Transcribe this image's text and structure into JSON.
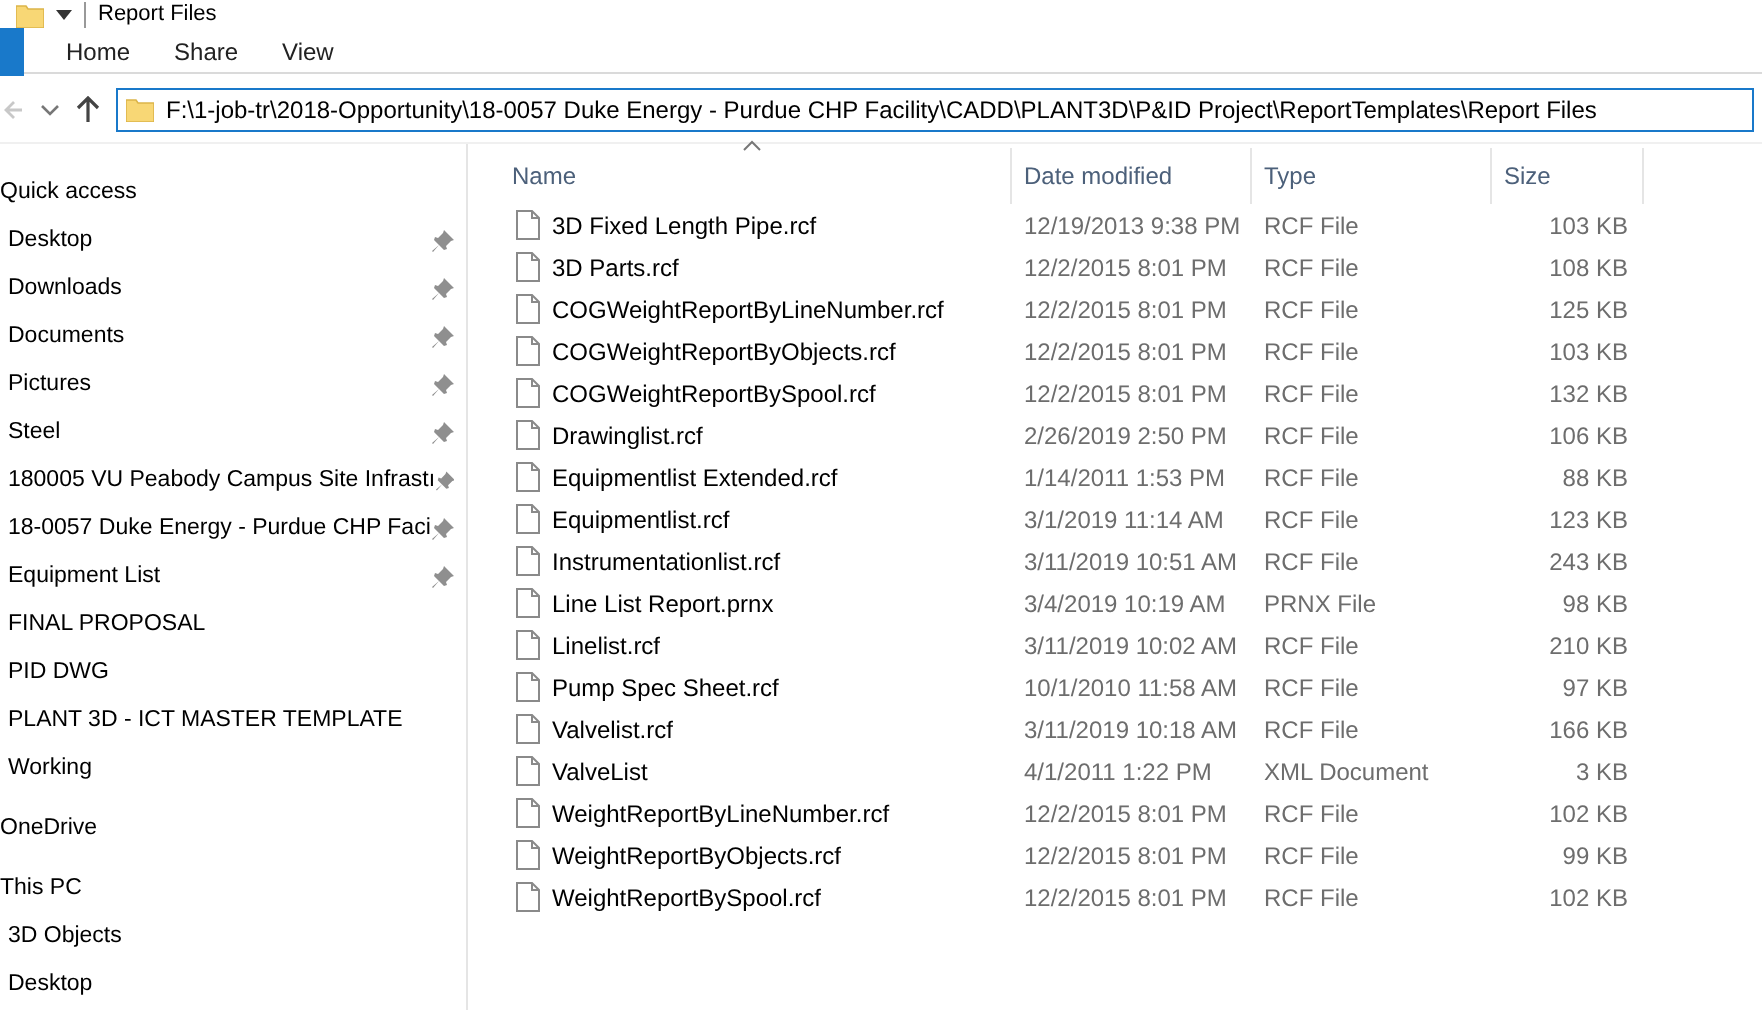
{
  "window": {
    "title": "Report Files"
  },
  "ribbon_tabs": [
    {
      "label": "Home",
      "selected": false
    },
    {
      "label": "Share",
      "selected": false
    },
    {
      "label": "View",
      "selected": false
    }
  ],
  "address": {
    "value": "F:\\1-job-tr\\2018-Opportunity\\18-0057 Duke Energy - Purdue CHP Facility\\CADD\\PLANT3D\\P&ID Project\\ReportTemplates\\Report Files"
  },
  "sidebar": {
    "items": [
      {
        "label": "Quick access",
        "children": [
          {
            "label": "Desktop",
            "pinned": true
          },
          {
            "label": "Downloads",
            "pinned": true
          },
          {
            "label": "Documents",
            "pinned": true
          },
          {
            "label": "Pictures",
            "pinned": true
          },
          {
            "label": "Steel",
            "pinned": true
          },
          {
            "label": "180005 VU Peabody Campus Site Infrastı",
            "pinned": true
          },
          {
            "label": "18-0057 Duke Energy - Purdue CHP Faci",
            "pinned": true
          },
          {
            "label": "Equipment List",
            "pinned": true
          },
          {
            "label": "FINAL PROPOSAL",
            "pinned": false
          },
          {
            "label": "PID DWG",
            "pinned": false
          },
          {
            "label": "PLANT 3D - ICT MASTER TEMPLATE",
            "pinned": false
          },
          {
            "label": "Working",
            "pinned": false
          }
        ]
      },
      {
        "label": "OneDrive"
      },
      {
        "label": "This PC",
        "children": [
          {
            "label": "3D Objects",
            "pinned": false
          },
          {
            "label": "Desktop",
            "pinned": false
          }
        ]
      }
    ]
  },
  "table": {
    "columns": [
      "Name",
      "Date modified",
      "Type",
      "Size"
    ],
    "rows": [
      [
        "3D Fixed Length Pipe.rcf",
        "12/19/2013 9:38 PM",
        "RCF File",
        "103 KB"
      ],
      [
        "3D Parts.rcf",
        "12/2/2015 8:01 PM",
        "RCF File",
        "108 KB"
      ],
      [
        "COGWeightReportByLineNumber.rcf",
        "12/2/2015 8:01 PM",
        "RCF File",
        "125 KB"
      ],
      [
        "COGWeightReportByObjects.rcf",
        "12/2/2015 8:01 PM",
        "RCF File",
        "103 KB"
      ],
      [
        "COGWeightReportBySpool.rcf",
        "12/2/2015 8:01 PM",
        "RCF File",
        "132 KB"
      ],
      [
        "Drawinglist.rcf",
        "2/26/2019 2:50 PM",
        "RCF File",
        "106 KB"
      ],
      [
        "Equipmentlist Extended.rcf",
        "1/14/2011 1:53 PM",
        "RCF File",
        "88 KB"
      ],
      [
        "Equipmentlist.rcf",
        "3/1/2019 11:14 AM",
        "RCF File",
        "123 KB"
      ],
      [
        "Instrumentationlist.rcf",
        "3/11/2019 10:51 AM",
        "RCF File",
        "243 KB"
      ],
      [
        "Line List Report.prnx",
        "3/4/2019 10:19 AM",
        "PRNX File",
        "98 KB"
      ],
      [
        "Linelist.rcf",
        "3/11/2019 10:02 AM",
        "RCF File",
        "210 KB"
      ],
      [
        "Pump Spec Sheet.rcf",
        "10/1/2010 11:58 AM",
        "RCF File",
        "97 KB"
      ],
      [
        "Valvelist.rcf",
        "3/11/2019 10:18 AM",
        "RCF File",
        "166 KB"
      ],
      [
        "ValveList",
        "4/1/2011 1:22 PM",
        "XML Document",
        "3 KB"
      ],
      [
        "WeightReportByLineNumber.rcf",
        "12/2/2015 8:01 PM",
        "RCF File",
        "102 KB"
      ],
      [
        "WeightReportByObjects.rcf",
        "12/2/2015 8:01 PM",
        "RCF File",
        "99 KB"
      ],
      [
        "WeightReportBySpool.rcf",
        "12/2/2015 8:01 PM",
        "RCF File",
        "102 KB"
      ]
    ]
  }
}
